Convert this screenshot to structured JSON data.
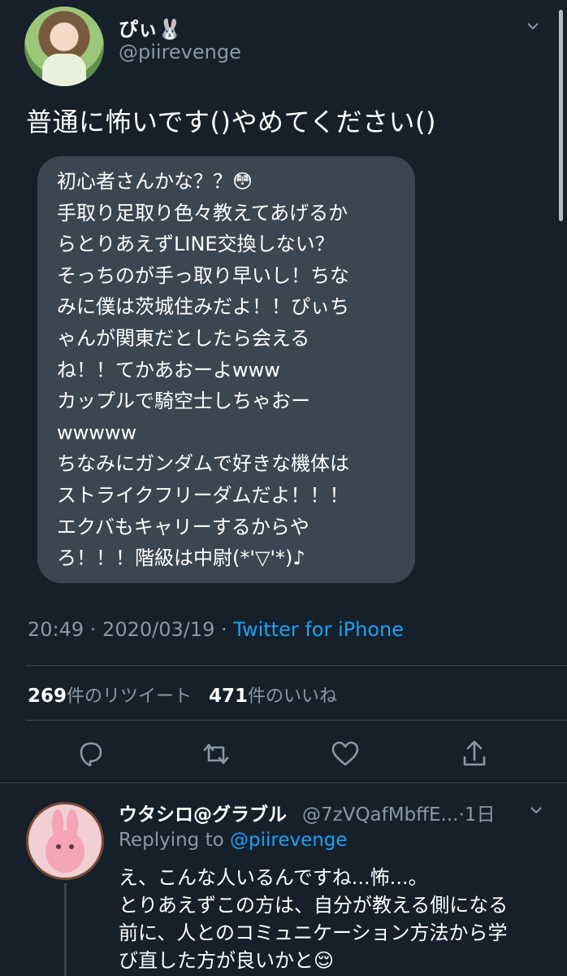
{
  "tweet": {
    "author_name": "ぴぃ🐰",
    "author_handle": "@piirevenge",
    "text": "普通に怖いです()やめてください()",
    "image_text_lines": [
      "初心者さんかな？？😳",
      "手取り足取り色々教えてあげるか",
      "らとりあえずLINE交換しない？",
      "そっちのが手っ取り早いし！ちな",
      "みに僕は茨城住みだよ！！ぴぃち",
      "ゃんが関東だとしたら会える",
      "ね！！てかあおーよwww",
      "カップルで騎空士しちゃおー",
      "wwwww",
      "ちなみにガンダムで好きな機体は",
      "ストライクフリーダムだよ！！！",
      "エクバもキャリーするからや",
      "ろ！！！階級は中尉(*'▽'*)♪"
    ],
    "time": "20:49 · 2020/03/19 · ",
    "source": "Twitter for iPhone",
    "retweets": "269",
    "retweets_label": "件のリツイート",
    "likes": "471",
    "likes_label": "件のいいね"
  },
  "actions": {
    "icons": [
      "reply-icon",
      "retweet-icon",
      "like-icon",
      "share-icon"
    ]
  },
  "reply": {
    "author_name": "ウタシロ@グラブル",
    "author_handle": "@7zVQafMbffE...",
    "time_ago": "·1日",
    "replying_prefix": "Replying to ",
    "replying_to": "@piirevenge",
    "text_lines": [
      "え、こんな人いるんですね...怖...。",
      "とりあえずこの方は、自分が教える側になる",
      "前に、人とのコミュニケーション方法から学",
      "び直した方が良いかと😌"
    ]
  },
  "colors": {
    "background": "#15202b",
    "secondary_text": "#8899a6",
    "link": "#1da1f2",
    "bubble": "#3b4653",
    "divider": "#38444d"
  }
}
